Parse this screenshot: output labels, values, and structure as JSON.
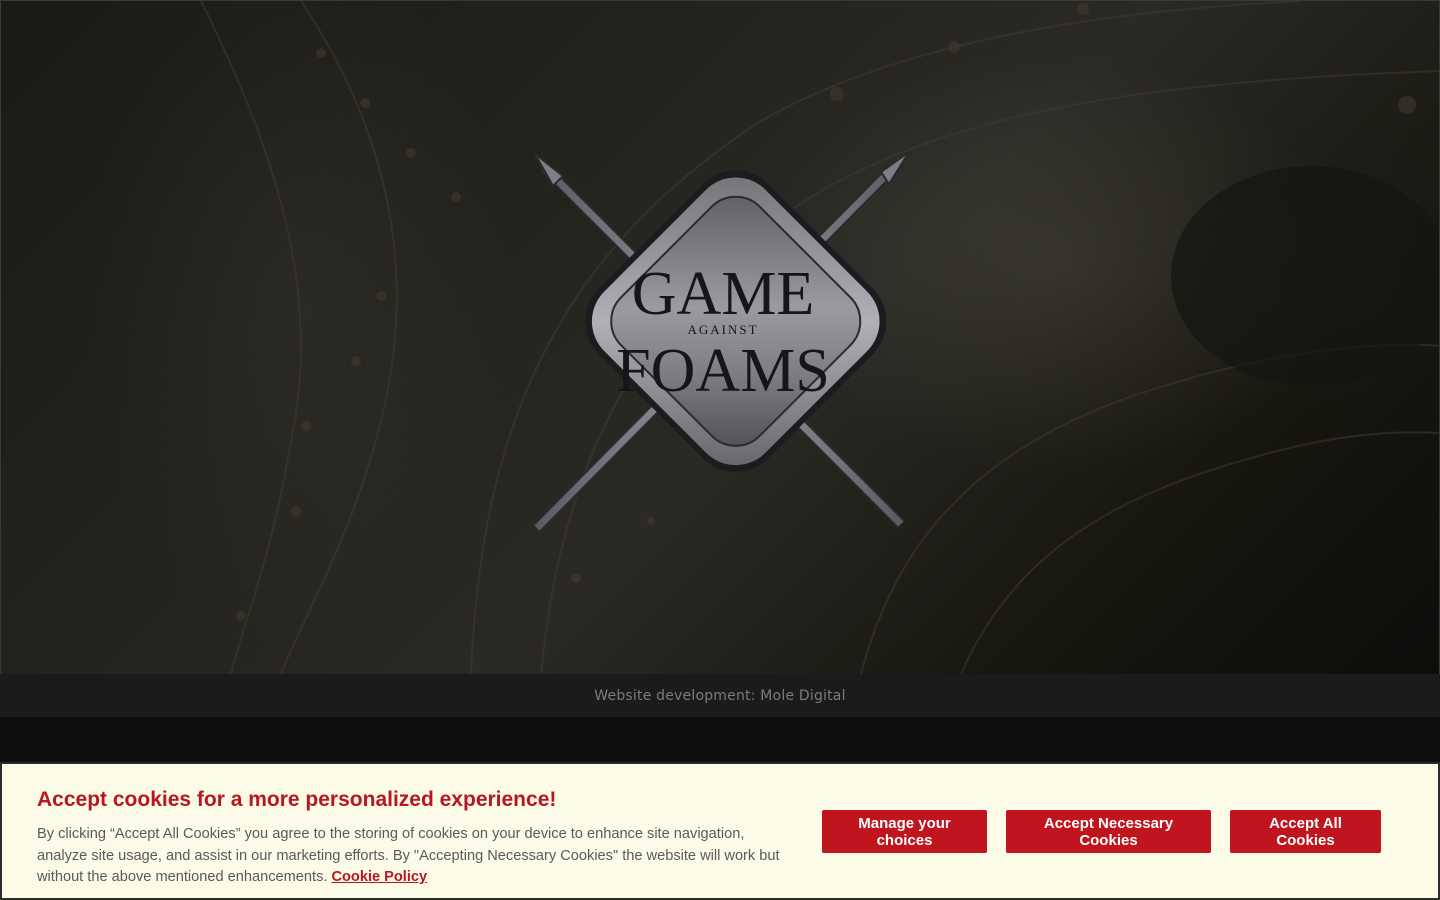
{
  "hero": {
    "logo": {
      "word_top": "GAME",
      "word_middle": "AGAINST",
      "word_bottom": "FOAMS"
    }
  },
  "footer": {
    "credit": "Website development: Mole Digital"
  },
  "cookie_banner": {
    "title": "Accept cookies for a more personalized experience!",
    "body": "By clicking “Accept All Cookies” you agree to the storing of cookies on your device to enhance site navigation, analyze site usage, and assist in our marketing efforts. By \"Accepting Necessary Cookies\" the website will work but without the above mentioned enhancements.",
    "policy_link": "Cookie Policy",
    "buttons": {
      "manage": "Manage your choices",
      "necessary": "Accept Necessary Cookies",
      "all": "Accept All Cookies"
    },
    "colors": {
      "accent": "#c0141e",
      "background": "#fcfbe8"
    }
  }
}
